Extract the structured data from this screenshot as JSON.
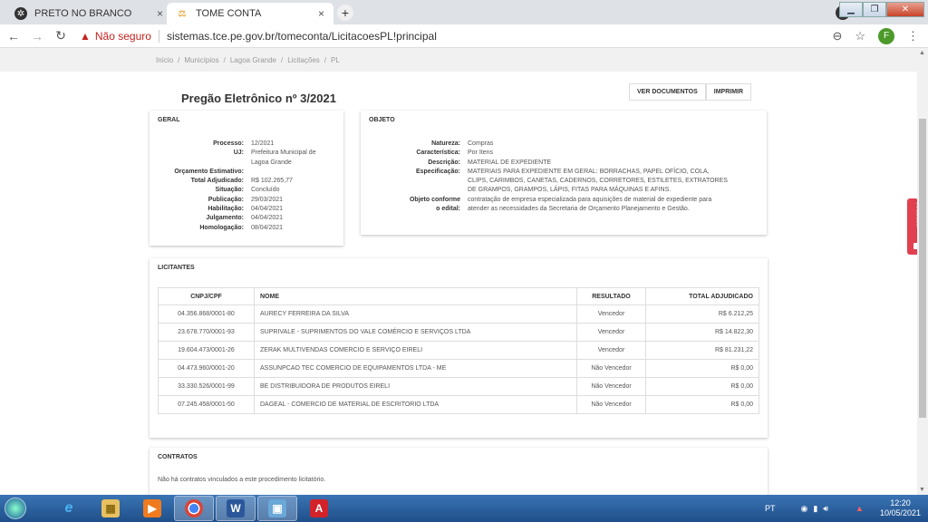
{
  "browser": {
    "tabs": [
      {
        "label": "PRETO NO BRANCO",
        "close": "×"
      },
      {
        "label": "TOME CONTA",
        "close": "×"
      }
    ],
    "new_tab": "+",
    "security_label": "Não seguro",
    "url": "sistemas.tce.pe.gov.br/tomeconta/LicitacoesPL!principal",
    "profile_initial": "F"
  },
  "breadcrumb": [
    "Início",
    "Municípios",
    "Lagoa Grande",
    "Licitações",
    "PL"
  ],
  "page_title": "Pregão Eletrônico nº 3/2021",
  "actions": {
    "documents": "VER DOCUMENTOS",
    "print": "IMPRIMIR"
  },
  "geral": {
    "title": "GERAL",
    "rows": [
      {
        "k": "Processo:",
        "v": "12/2021"
      },
      {
        "k": "UJ:",
        "v": "Prefeitura Municipal de"
      },
      {
        "k": "",
        "v": "Lagoa Grande"
      },
      {
        "k": "Orçamento Estimativo:",
        "v": ""
      },
      {
        "k": "Total Adjudicado:",
        "v": "R$ 102.265,77"
      },
      {
        "k": "Situação:",
        "v": "Concluído"
      },
      {
        "k": "Publicação:",
        "v": "29/03/2021"
      },
      {
        "k": "Habilitação:",
        "v": "04/04/2021"
      },
      {
        "k": "Julgamento:",
        "v": "04/04/2021"
      },
      {
        "k": "Homologação:",
        "v": "08/04/2021"
      }
    ]
  },
  "objeto": {
    "title": "OBJETO",
    "rows": [
      {
        "k": "Natureza:",
        "v": "Compras"
      },
      {
        "k": "Característica:",
        "v": "Por Itens"
      },
      {
        "k": "Descrição:",
        "v": "MATERIAL DE EXPEDIENTE"
      },
      {
        "k": "Especificação:",
        "v": "MATERIAIS PARA EXPEDIENTE EM GERAL: BORRACHAS, PAPEL OFÍCIO, COLA,"
      },
      {
        "k": "",
        "v": "CLIPS, CARIMBOS, CANETAS, CADERNOS, CORRETORES, ESTILETES, EXTRATORES"
      },
      {
        "k": "",
        "v": "DE GRAMPOS, GRAMPOS, LÁPIS, FITAS PARA MÁQUINAS E AFINS."
      },
      {
        "k": "Objeto conforme",
        "v": "contratação de empresa especializada para aquisições de material de expediente para"
      },
      {
        "k": "o edital:",
        "v": "atender as necessidades da Secretaria de Orçamento Planejamento e Gestão."
      }
    ]
  },
  "licitantes": {
    "title": "LICITANTES",
    "headers": [
      "CNPJ/CPF",
      "NOME",
      "RESULTADO",
      "TOTAL ADJUDICADO"
    ],
    "rows": [
      [
        "04.356.868/0001-80",
        "AURECY FERREIRA DA SILVA",
        "Vencedor",
        "R$ 6.212,25"
      ],
      [
        "23.678.770/0001-93",
        "SUPRIVALE - SUPRIMENTOS DO VALE COMÉRCIO E SERVIÇOS LTDA",
        "Vencedor",
        "R$ 14.822,30"
      ],
      [
        "19.604.473/0001-26",
        "ZERAK MULTIVENDAS COMERCIO E SERVIÇO EIRELI",
        "Vencedor",
        "R$ 81.231,22"
      ],
      [
        "04.473.960/0001-20",
        "ASSUNPCAO TEC COMERCIO DE EQUIPAMENTOS LTDA - ME",
        "Não Vencedor",
        "R$ 0,00"
      ],
      [
        "33.330.526/0001-99",
        "BE DISTRIBUIDORA DE PRODUTOS EIRELI",
        "Não Vencedor",
        "R$ 0,00"
      ],
      [
        "07.245.458/0001-50",
        "DAGEAL - COMERCIO DE MATERIAL DE ESCRITORIO LTDA",
        "Não Vencedor",
        "R$ 0,00"
      ]
    ]
  },
  "contratos": {
    "title": "CONTRATOS",
    "empty_text": "Não há contratos vinculados a este procedimento licitatório."
  },
  "feedback_label": "Feedback",
  "taskbar": {
    "language": "PT",
    "time": "12:20",
    "date": "10/05/2021",
    "items": [
      {
        "icon": "ie-icon",
        "glyph": "e"
      },
      {
        "icon": "explorer-icon",
        "glyph": "▦"
      },
      {
        "icon": "media-player-icon",
        "glyph": "▶"
      },
      {
        "icon": "chrome-icon",
        "glyph": "●"
      },
      {
        "icon": "word-icon",
        "glyph": "W"
      },
      {
        "icon": "image-viewer-icon",
        "glyph": "▣"
      },
      {
        "icon": "pdf-icon",
        "glyph": "A"
      }
    ]
  },
  "colors": {
    "security_warn": "#c5221f",
    "feedback": "#e04050",
    "taskbar": "#1f4f8a"
  }
}
